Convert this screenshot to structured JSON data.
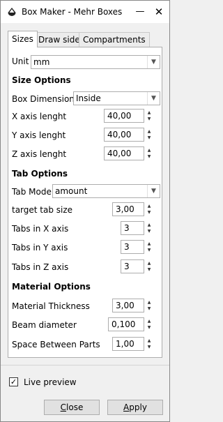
{
  "window": {
    "title": "Box Maker - Mehr Boxes",
    "minimize_glyph": "—",
    "close_glyph": "✕"
  },
  "tabs": [
    {
      "label": "Sizes",
      "active": true
    },
    {
      "label": "Draw sides",
      "active": false
    },
    {
      "label": "Compartments",
      "active": false
    }
  ],
  "unit": {
    "label": "Unit",
    "value": "mm"
  },
  "size_options": {
    "heading": "Size Options",
    "box_dimensions": {
      "label": "Box Dimensions",
      "value": "Inside"
    },
    "x_axis": {
      "label": "X axis lenght",
      "value": "40,00"
    },
    "y_axis": {
      "label": "Y axis lenght",
      "value": "40,00"
    },
    "z_axis": {
      "label": "Z axis lenght",
      "value": "40,00"
    }
  },
  "tab_options": {
    "heading": "Tab Options",
    "tab_mode": {
      "label": "Tab Mode",
      "value": "amount"
    },
    "target_tab_size": {
      "label": "target tab size",
      "value": "3,00"
    },
    "tabs_x": {
      "label": "Tabs in X axis",
      "value": "3"
    },
    "tabs_y": {
      "label": "Tabs in Y axis",
      "value": "3"
    },
    "tabs_z": {
      "label": "Tabs in Z axis",
      "value": "3"
    }
  },
  "material_options": {
    "heading": "Material Options",
    "thickness": {
      "label": "Material Thickness",
      "value": "3,00"
    },
    "beam": {
      "label": "Beam diameter",
      "value": "0,100"
    },
    "spacing": {
      "label": "Space Between Parts",
      "value": "1,00"
    }
  },
  "live_preview": {
    "label": "Live preview",
    "checked": true,
    "check_glyph": "✓"
  },
  "buttons": {
    "close": {
      "mnemonic": "C",
      "rest": "lose"
    },
    "apply": {
      "mnemonic": "A",
      "rest": "pply"
    }
  },
  "glyphs": {
    "dropdown_arrow": "▼",
    "spin_up": "▲",
    "spin_down": "▼"
  },
  "colors": {
    "window_bg": "#f0f0f0",
    "panel_bg": "#ffffff",
    "border": "#adadad"
  }
}
